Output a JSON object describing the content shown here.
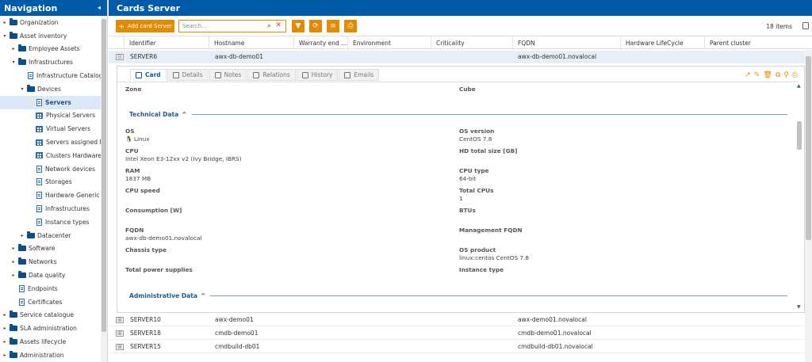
{
  "nav": {
    "title": "Navigation",
    "collapse_icon": "chevron-left-icon",
    "items": [
      {
        "label": "Organization",
        "level": 0,
        "type": "folder",
        "toggle": "▸"
      },
      {
        "label": "Asset inventory",
        "level": 0,
        "type": "folder",
        "toggle": "▾"
      },
      {
        "label": "Employee Assets",
        "level": 1,
        "type": "folder",
        "toggle": "▸"
      },
      {
        "label": "Infrastructures",
        "level": 1,
        "type": "folder",
        "toggle": "▾"
      },
      {
        "label": "Infrastructure Catalog...",
        "level": 2,
        "type": "doc",
        "toggle": ""
      },
      {
        "label": "Devices",
        "level": 2,
        "type": "folder",
        "toggle": "▾"
      },
      {
        "label": "Servers",
        "level": 3,
        "type": "doc",
        "toggle": "",
        "selected": true
      },
      {
        "label": "Physical Servers",
        "level": 3,
        "type": "grid",
        "toggle": ""
      },
      {
        "label": "Virtual Servers",
        "level": 3,
        "type": "grid",
        "toggle": ""
      },
      {
        "label": "Servers assigned IPs",
        "level": 3,
        "type": "grid",
        "toggle": ""
      },
      {
        "label": "Clusters Hardware",
        "level": 3,
        "type": "grid",
        "toggle": ""
      },
      {
        "label": "Network devices",
        "level": 3,
        "type": "doc",
        "toggle": ""
      },
      {
        "label": "Storages",
        "level": 3,
        "type": "doc",
        "toggle": ""
      },
      {
        "label": "Hardware Generic",
        "level": 3,
        "type": "doc",
        "toggle": ""
      },
      {
        "label": "Infrastructures",
        "level": 3,
        "type": "doc",
        "toggle": ""
      },
      {
        "label": "Instance types",
        "level": 3,
        "type": "doc",
        "toggle": ""
      },
      {
        "label": "Datacenter",
        "level": 2,
        "type": "folder",
        "toggle": "▸"
      },
      {
        "label": "Software",
        "level": 1,
        "type": "folder",
        "toggle": "▸"
      },
      {
        "label": "Networks",
        "level": 1,
        "type": "folder",
        "toggle": "▸"
      },
      {
        "label": "Data quality",
        "level": 1,
        "type": "folder",
        "toggle": "▸"
      },
      {
        "label": "Endpoints",
        "level": 1,
        "type": "doc",
        "toggle": ""
      },
      {
        "label": "Certificates",
        "level": 1,
        "type": "doc",
        "toggle": ""
      },
      {
        "label": "Service catalogue",
        "level": 0,
        "type": "folder",
        "toggle": "▸"
      },
      {
        "label": "SLA administration",
        "level": 0,
        "type": "folder",
        "toggle": "▸"
      },
      {
        "label": "Assets lifecycle",
        "level": 0,
        "type": "folder",
        "toggle": "▸"
      },
      {
        "label": "Administration",
        "level": 0,
        "type": "folder",
        "toggle": "▸"
      }
    ]
  },
  "main": {
    "title": "Cards Server",
    "toolbar": {
      "add_label": "Add card Server",
      "add_icon": "+",
      "search_placeholder": "Search...",
      "search_icon": "⌕",
      "clear_icon": "✕",
      "filter_icon": "▼",
      "refresh_icon": "⟳",
      "menu_icon": "≡",
      "print_icon": "⎙",
      "items_count": "18 items"
    },
    "columns": [
      "Identifier",
      "Hostname",
      "Warranty end ...",
      "Environment",
      "Criticality",
      "FQDN",
      "Hardware LifeCycle",
      "Parent cluster"
    ],
    "rows": [
      {
        "expand": "⊟",
        "identifier": "SERVER6",
        "hostname": "awx-db-demo01",
        "fqdn": "awx-db-demo01.novalocal"
      },
      {
        "expand": "⊞",
        "identifier": "SERVER10",
        "hostname": "awx-demo01",
        "fqdn": "awx-demo01.novalocal"
      },
      {
        "expand": "⊞",
        "identifier": "SERVER18",
        "hostname": "cmdb-demo01",
        "fqdn": "cmdb-demo01.novalocal"
      },
      {
        "expand": "⊞",
        "identifier": "SERVER15",
        "hostname": "cmdbuild-db01",
        "fqdn": "cmdbuild-db01.novalocal"
      }
    ]
  },
  "card": {
    "tabs": [
      "Card",
      "Details",
      "Notes",
      "Relations",
      "History",
      "Emails"
    ],
    "actions": [
      "↗",
      "✎",
      "🗑",
      "⧉",
      "⚲",
      "⎙"
    ],
    "top_fields": [
      {
        "label": "Zone",
        "value": ""
      },
      {
        "label": "Cube",
        "value": ""
      }
    ],
    "technical_title": "Technical Data",
    "collapse_icon": "^",
    "technical": [
      {
        "label": "OS",
        "value": "Linux",
        "icon": "linux-icon"
      },
      {
        "label": "OS version",
        "value": "CentOS 7.8"
      },
      {
        "label": "CPU",
        "value": "Intel Xeon E3-12xx v2 (Ivy Bridge, IBRS)"
      },
      {
        "label": "HD total size [GB]",
        "value": ""
      },
      {
        "label": "RAM",
        "value": "1837 MB"
      },
      {
        "label": "CPU type",
        "value": "64-bit"
      },
      {
        "label": "CPU speed",
        "value": ""
      },
      {
        "label": "Total CPUs",
        "value": "1"
      },
      {
        "label": "Consumption [W]",
        "value": ""
      },
      {
        "label": "BTUs",
        "value": ""
      },
      {
        "label": "FQDN",
        "value": "awx-db-demo01.novalocal"
      },
      {
        "label": "Management FQDN",
        "value": ""
      },
      {
        "label": "Chassis type",
        "value": ""
      },
      {
        "label": "OS product",
        "value": "linux:centos CentOS 7.8"
      },
      {
        "label": "Total power supplies",
        "value": ""
      },
      {
        "label": "Instance type",
        "value": ""
      }
    ],
    "administrative_title": "Administrative Data"
  },
  "colors": {
    "header_blue": "#005ca9",
    "accent_orange": "#e38b00",
    "selected_row": "#dbe8f6",
    "expanded_row": "#e6eef7"
  }
}
